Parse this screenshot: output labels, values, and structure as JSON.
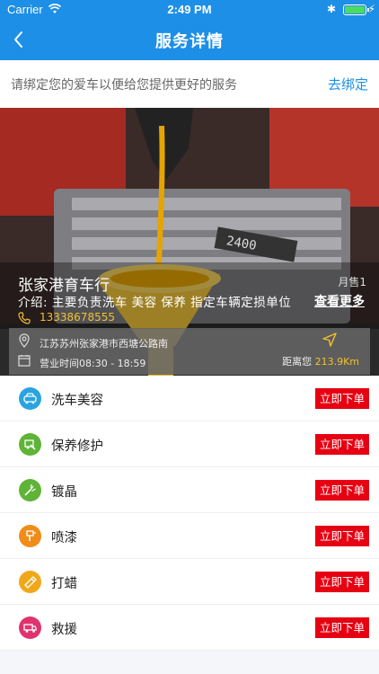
{
  "status_bar": {
    "carrier": "Carrier",
    "time": "2:49 PM",
    "bluetooth": "✱",
    "charging": "⚡"
  },
  "nav": {
    "title": "服务详情"
  },
  "bind_bar": {
    "hint": "请绑定您的爱车以便给您提供更好的服务",
    "link": "去绑定"
  },
  "shop": {
    "name": "张家港育车行",
    "monthly_sales": "月售1",
    "intro": "介绍:  主要负责洗车 美容 保养  指定车辆定损单位",
    "more": "查看更多",
    "phone": "13338678555",
    "address": "江苏苏州张家港市西塘公路南",
    "hours": "营业时间08:30 - 18:59",
    "distance_prefix": "距离您",
    "distance": "213.9Km"
  },
  "services": [
    {
      "label": "洗车美容",
      "icon": "car-wash-icon",
      "color": "#2aa3e0",
      "order": "立即下单"
    },
    {
      "label": "保养修护",
      "icon": "maintenance-icon",
      "color": "#5fb336",
      "order": "立即下单"
    },
    {
      "label": "镀晶",
      "icon": "spray-icon",
      "color": "#5fb336",
      "order": "立即下单"
    },
    {
      "label": "喷漆",
      "icon": "paint-gun-icon",
      "color": "#f08c1a",
      "order": "立即下单"
    },
    {
      "label": "打蜡",
      "icon": "wax-icon",
      "color": "#f0a81a",
      "order": "立即下单"
    },
    {
      "label": "救援",
      "icon": "rescue-icon",
      "color": "#e0336e",
      "order": "立即下单"
    }
  ],
  "colors": {
    "nav_bg": "#1e8fe6",
    "order_button": "#e60012",
    "accent_yellow": "#f2c12e"
  }
}
